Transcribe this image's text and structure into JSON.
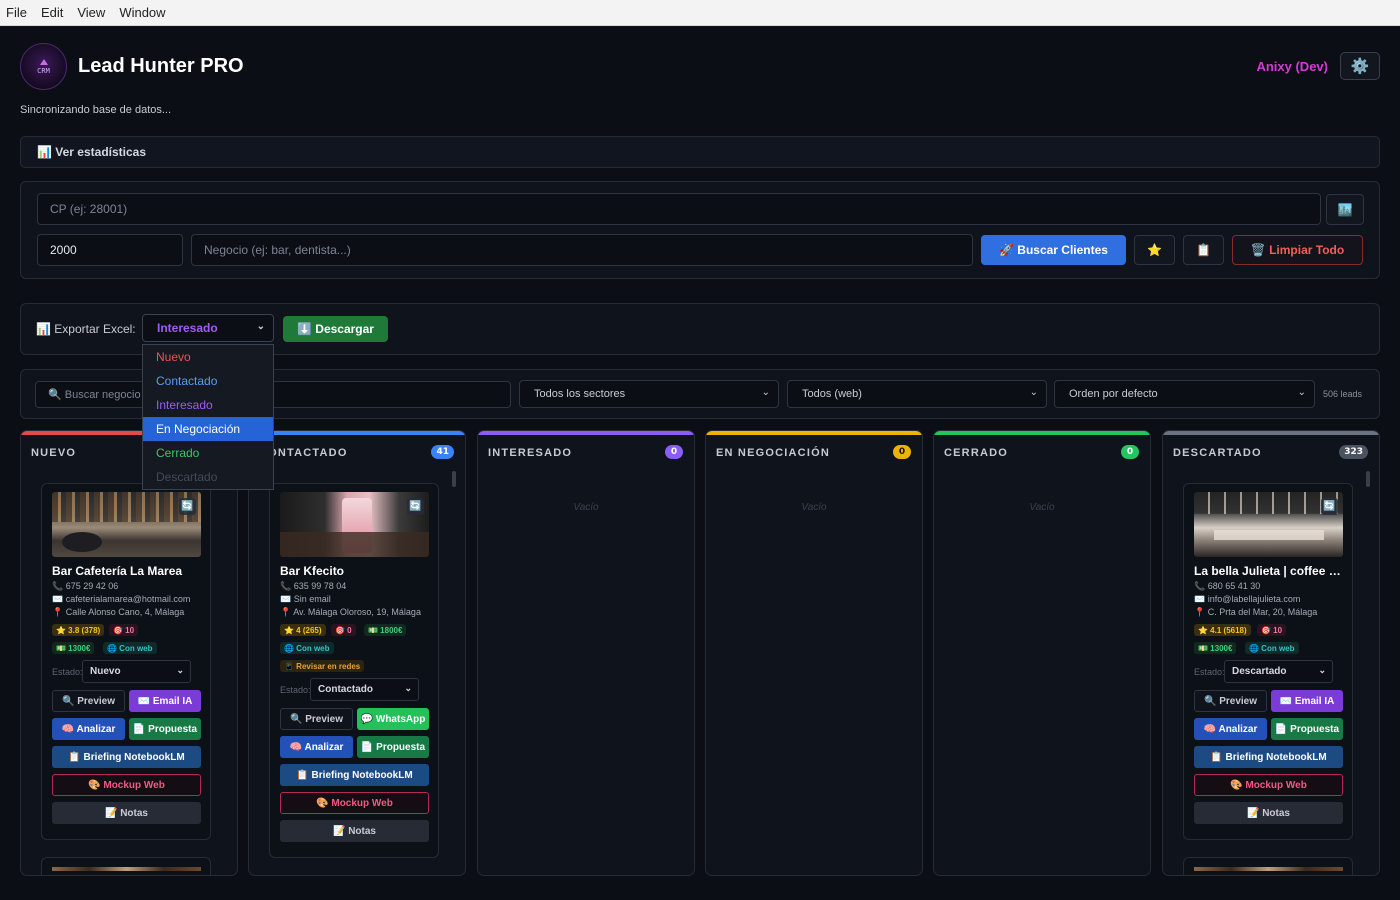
{
  "menubar": {
    "items": [
      "File",
      "Edit",
      "View",
      "Window"
    ]
  },
  "header": {
    "logo_text": "CRM",
    "title": "Lead Hunter PRO",
    "user": "Anixy (Dev)",
    "sync_status": "Sincronizando base de datos..."
  },
  "stats": {
    "label": "📊 Ver estadísticas"
  },
  "search": {
    "cp_placeholder": "CP (ej: 28001)",
    "radius_value": "2000",
    "business_placeholder": "Negocio (ej: bar, dentista...)",
    "search_button": "🚀 Buscar Clientes",
    "clear_button": "🗑️ Limpiar Todo",
    "star_icon": "⭐",
    "clipboard_icon": "📋",
    "building_icon": "🏙️"
  },
  "export": {
    "label": "📊 Exportar Excel:",
    "selected": "Interesado",
    "download_button": "⬇️ Descargar",
    "options": [
      "Nuevo",
      "Contactado",
      "Interesado",
      "En Negociación",
      "Cerrado",
      "Descartado"
    ],
    "highlighted_index": 3
  },
  "filters": {
    "search_placeholder": "🔍 Buscar negocio",
    "sector": "Todos los sectores",
    "web": "Todos (web)",
    "order": "Orden por defecto",
    "count": "506 leads"
  },
  "colors": {
    "accent_blue": "#2f6fe0",
    "nuevo": "#e5484d",
    "contactado": "#3b82f6",
    "interesado": "#8b5cf6",
    "negociacion": "#eab308",
    "cerrado": "#22c55e",
    "descartado": "#6b7280",
    "user": "#d63ad6"
  },
  "columns": [
    {
      "title": "NUEVO",
      "badge": "",
      "empty": ""
    },
    {
      "title": "CONTACTADO",
      "badge": "41",
      "empty": ""
    },
    {
      "title": "INTERESADO",
      "badge": "0",
      "empty": "Vacío"
    },
    {
      "title": "EN NEGOCIACIÓN",
      "badge": "0",
      "empty": "Vacío"
    },
    {
      "title": "CERRADO",
      "badge": "0",
      "empty": "Vacío"
    },
    {
      "title": "DESCARTADO",
      "badge": "323",
      "empty": ""
    }
  ],
  "cards": [
    {
      "name": "Bar Cafetería La Marea",
      "phone": "📞 675 29 42 06",
      "email": "✉️ cafeterialamarea@hotmail.com",
      "address": "📍 Calle Alonso Cano, 4, Málaga",
      "rating": "⭐ 3.8 (378)",
      "score": "🎯 10",
      "price": "💵 1300€",
      "web": "🌐 Con web",
      "state_label": "Estado:",
      "state": "Nuevo",
      "buttons": {
        "preview": "🔍 Preview",
        "email": "✉️ Email IA",
        "analyze": "🧠 Analizar",
        "proposal": "📄 Propuesta",
        "briefing": "📋 Briefing NotebookLM",
        "mockup": "🎨 Mockup Web",
        "notes": "📝 Notas"
      }
    },
    {
      "name": "Bar Kfecito",
      "phone": "📞 635 99 78 04",
      "email": "✉️ Sin email",
      "address": "📍 Av. Málaga Oloroso, 19, Málaga",
      "rating": "⭐ 4 (265)",
      "score": "🎯 0",
      "price": "💵 1800€",
      "web": "🌐 Con web",
      "review": "📱 Revisar en redes",
      "state_label": "Estado:",
      "state": "Contactado",
      "buttons": {
        "preview": "🔍 Preview",
        "whatsapp": "💬 WhatsApp",
        "analyze": "🧠 Analizar",
        "proposal": "📄 Propuesta",
        "briefing": "📋 Briefing NotebookLM",
        "mockup": "🎨 Mockup Web",
        "notes": "📝 Notas"
      }
    },
    {
      "name": "La bella Julieta | coffee & more",
      "phone": "📞 680 65 41 30",
      "email": "✉️ info@labellajulieta.com",
      "address": "📍 C. Prta del Mar, 20, Málaga",
      "rating": "⭐ 4.1 (5618)",
      "score": "🎯 10",
      "price": "💵 1300€",
      "web": "🌐 Con web",
      "state_label": "Estado:",
      "state": "Descartado",
      "buttons": {
        "preview": "🔍 Preview",
        "email": "✉️ Email IA",
        "analyze": "🧠 Analizar",
        "proposal": "📄 Propuesta",
        "briefing": "📋 Briefing NotebookLM",
        "mockup": "🎨 Mockup Web",
        "notes": "📝 Notas"
      }
    }
  ],
  "icons": {
    "refresh": "🔄",
    "chevron": "⌄",
    "gear": "⚙️"
  }
}
